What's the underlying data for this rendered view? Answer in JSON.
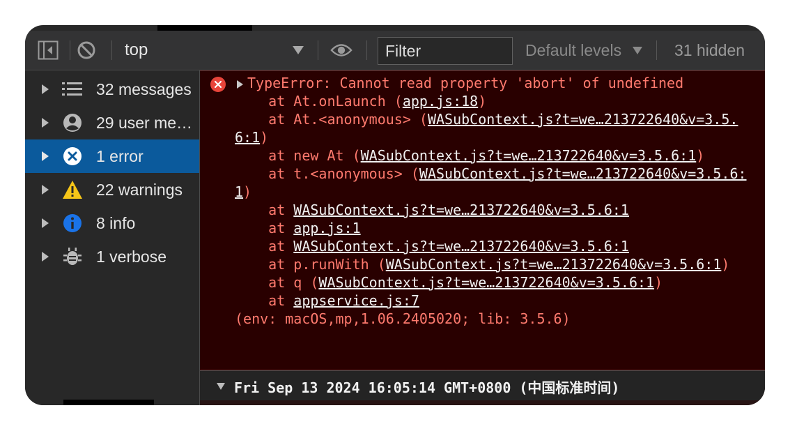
{
  "toolbar": {
    "context": "top",
    "filter_placeholder": "Filter",
    "levels": "Default levels",
    "hidden": "31 hidden",
    "icons": [
      "sidebar-toggle-icon",
      "clear-console-icon",
      "eye-icon"
    ]
  },
  "sidebar": {
    "items": [
      {
        "label": "32 messages",
        "icon": "list-icon"
      },
      {
        "label": "29 user me…",
        "icon": "user-icon"
      },
      {
        "label": "1 error",
        "icon": "error-icon",
        "selected": true
      },
      {
        "label": "22 warnings",
        "icon": "warning-icon"
      },
      {
        "label": "8 info",
        "icon": "info-icon"
      },
      {
        "label": "1 verbose",
        "icon": "bug-icon"
      }
    ]
  },
  "console": {
    "error": {
      "head": "TypeError: Cannot read property 'abort' of undefined",
      "frames": [
        {
          "prefix": "    at At.onLaunch (",
          "link": "app.js:18",
          "suffix": ")"
        },
        {
          "prefix": "    at At.<anonymous> (",
          "link": "WASubContext.js?t=we…213722640&v=3.5.6:1",
          "suffix": ")"
        },
        {
          "prefix": "    at new At (",
          "link": "WASubContext.js?t=we…213722640&v=3.5.6:1",
          "suffix": ")"
        },
        {
          "prefix": "    at t.<anonymous> (",
          "link": "WASubContext.js?t=we…213722640&v=3.5.6:1",
          "suffix": ")"
        },
        {
          "prefix": "    at ",
          "link": "WASubContext.js?t=we…213722640&v=3.5.6:1",
          "suffix": ""
        },
        {
          "prefix": "    at ",
          "link": "app.js:1",
          "suffix": ""
        },
        {
          "prefix": "    at ",
          "link": "WASubContext.js?t=we…213722640&v=3.5.6:1",
          "suffix": ""
        },
        {
          "prefix": "    at p.runWith (",
          "link": "WASubContext.js?t=we…213722640&v=3.5.6:1",
          "suffix": ")"
        },
        {
          "prefix": "    at q (",
          "link": "WASubContext.js?t=we…213722640&v=3.5.6:1",
          "suffix": ")"
        },
        {
          "prefix": "    at ",
          "link": "appservice.js:7",
          "suffix": ""
        }
      ],
      "env": "(env: macOS,mp,1.06.2405020; lib: 3.5.6)"
    },
    "timestamp": "Fri Sep 13 2024 16:05:14 GMT+0800 (中国标准时间)"
  },
  "colors": {
    "error_text": "#ff7a6e",
    "error_bg": "#290000",
    "selected_bg": "#0b5a9c",
    "warning": "#f5c518",
    "info": "#1a73e8"
  }
}
